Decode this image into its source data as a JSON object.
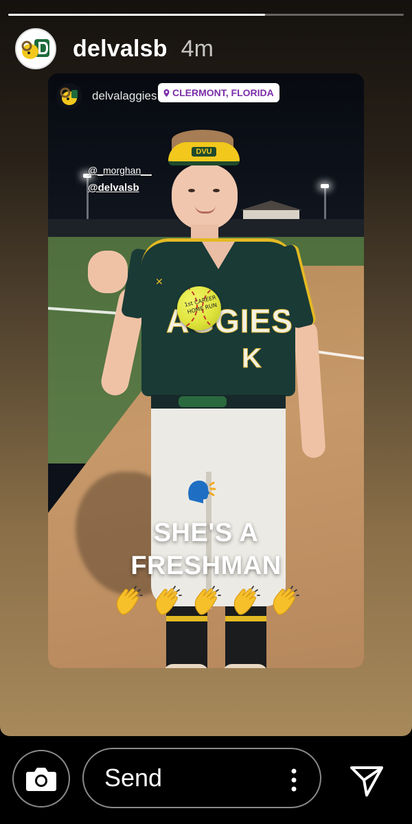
{
  "story": {
    "username": "delvalsb",
    "time_ago": "4m",
    "progress": 0.65
  },
  "reposted": {
    "username": "delvalaggies",
    "location": "CLERMONT, FLORIDA",
    "mentions": [
      "@_morghan__",
      "@delvalsb"
    ],
    "ball_text": "1st CAREER HOME RUN",
    "jersey_text": "AGGIES",
    "jersey_number": "K",
    "visor_logo": "DVU",
    "caption_line1": "SHE'S A",
    "caption_line2": "FRESHMAN",
    "stickers": {
      "speaking_icon": "speaking-head-emoji",
      "clap_icon": "clapping-hands-emoji",
      "clap_count": 5
    }
  },
  "bottom_bar": {
    "send_placeholder": "Send",
    "camera_icon": "camera-icon",
    "more_icon": "more-vertical-icon",
    "direct_icon": "direct-message-icon"
  },
  "colors": {
    "location_text": "#7b2da8",
    "jersey_green": "#1a3a36",
    "team_gold": "#e3b923",
    "ball_yellow": "#dfe43c"
  }
}
